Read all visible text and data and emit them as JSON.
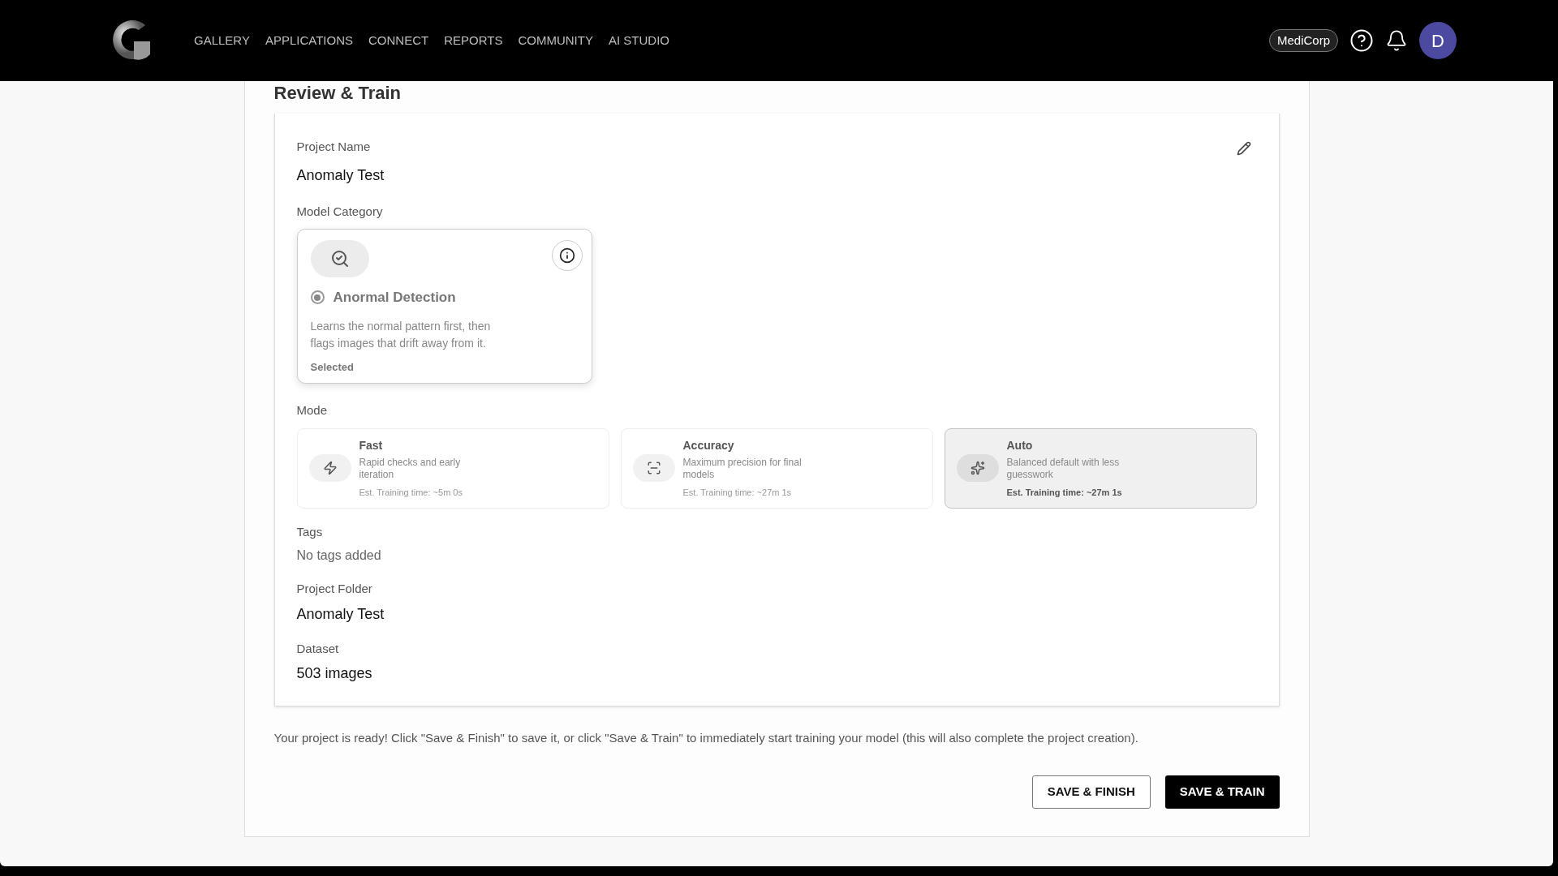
{
  "nav": {
    "items": [
      "GALLERY",
      "APPLICATIONS",
      "CONNECT",
      "REPORTS",
      "COMMUNITY",
      "AI STUDIO"
    ],
    "org": "MediCorp",
    "avatar": "D"
  },
  "page": {
    "title": "Review & Train"
  },
  "summary": {
    "project_name": {
      "label": "Project Name",
      "value": "Anomaly Test"
    },
    "model_category": {
      "label": "Model Category",
      "card": {
        "title": "Anormal Detection",
        "description": "Learns the normal pattern first, then flags images that drift away from it.",
        "status": "Selected",
        "selected": true
      }
    },
    "mode": {
      "label": "Mode",
      "options": [
        {
          "kind": "fast",
          "title": "Fast",
          "description": "Rapid checks and early iteration",
          "time": "Est. Training time: ~5m 0s",
          "selected": false
        },
        {
          "kind": "accuracy",
          "title": "Accuracy",
          "description": "Maximum precision for final models",
          "time": "Est. Training time: ~27m 1s",
          "selected": false
        },
        {
          "kind": "auto",
          "title": "Auto",
          "description": "Balanced default with less guesswork",
          "time": "Est. Training time: ~27m 1s",
          "selected": true
        }
      ]
    },
    "fields": [
      {
        "label": "Tags",
        "value": "No tags added",
        "empty": true
      },
      {
        "label": "Project Folder",
        "value": "Anomaly Test",
        "empty": false
      },
      {
        "label": "Dataset",
        "value": "503 images",
        "empty": false
      }
    ]
  },
  "footer": {
    "message": "Your project is ready! Click \"Save & Finish\" to save it, or click \"Save & Train\" to immediately start training your model (this will also complete the project creation).",
    "buttons": [
      {
        "label": "SAVE & FINISH",
        "primary": false
      },
      {
        "label": "SAVE & TRAIN",
        "primary": true
      }
    ]
  }
}
